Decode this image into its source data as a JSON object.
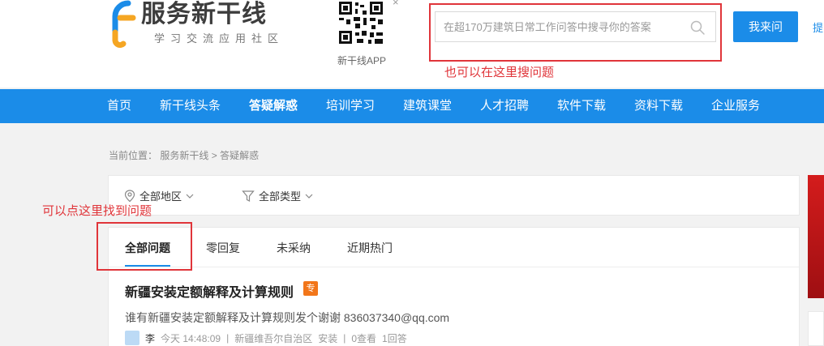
{
  "header": {
    "logo_title": "服务新干线",
    "logo_subtitle": "学习交流应用社区",
    "qr_label": "新干线APP",
    "qr_close": "×",
    "search_placeholder": "在超170万建筑日常工作问答中搜寻你的答案",
    "ask_button": "我来问",
    "cut_text": "提"
  },
  "annotations": {
    "search_note": "也可以在这里搜问题",
    "tab_note": "可以点这里找到问题"
  },
  "nav": {
    "items": [
      "首页",
      "新干线头条",
      "答疑解惑",
      "培训学习",
      "建筑课堂",
      "人才招聘",
      "软件下载",
      "资料下载",
      "企业服务"
    ],
    "active_index": 2
  },
  "breadcrumb": {
    "prefix": "当前位置：",
    "home": "服务新干线",
    "sep": ">",
    "current": "答疑解惑"
  },
  "filters": {
    "region": "全部地区",
    "type": "全部类型"
  },
  "tabs": {
    "items": [
      "全部问题",
      "零回复",
      "未采纳",
      "近期热门"
    ],
    "active_index": 0
  },
  "question": {
    "title": "新疆安装定额解释及计算规则",
    "badge": "专",
    "desc": "谁有新疆安装定额解释及计算规则发个谢谢  836037340@qq.com",
    "author": "李",
    "time": "今天 14:48:09",
    "region": "新疆维吾尔自治区",
    "category": "安装",
    "views": "0查看",
    "answers": "1回答",
    "meta_sep": "|"
  },
  "colors": {
    "brand_blue": "#1b8ce8",
    "annotation_red": "#e0353a",
    "badge_orange": "#f2761a"
  }
}
